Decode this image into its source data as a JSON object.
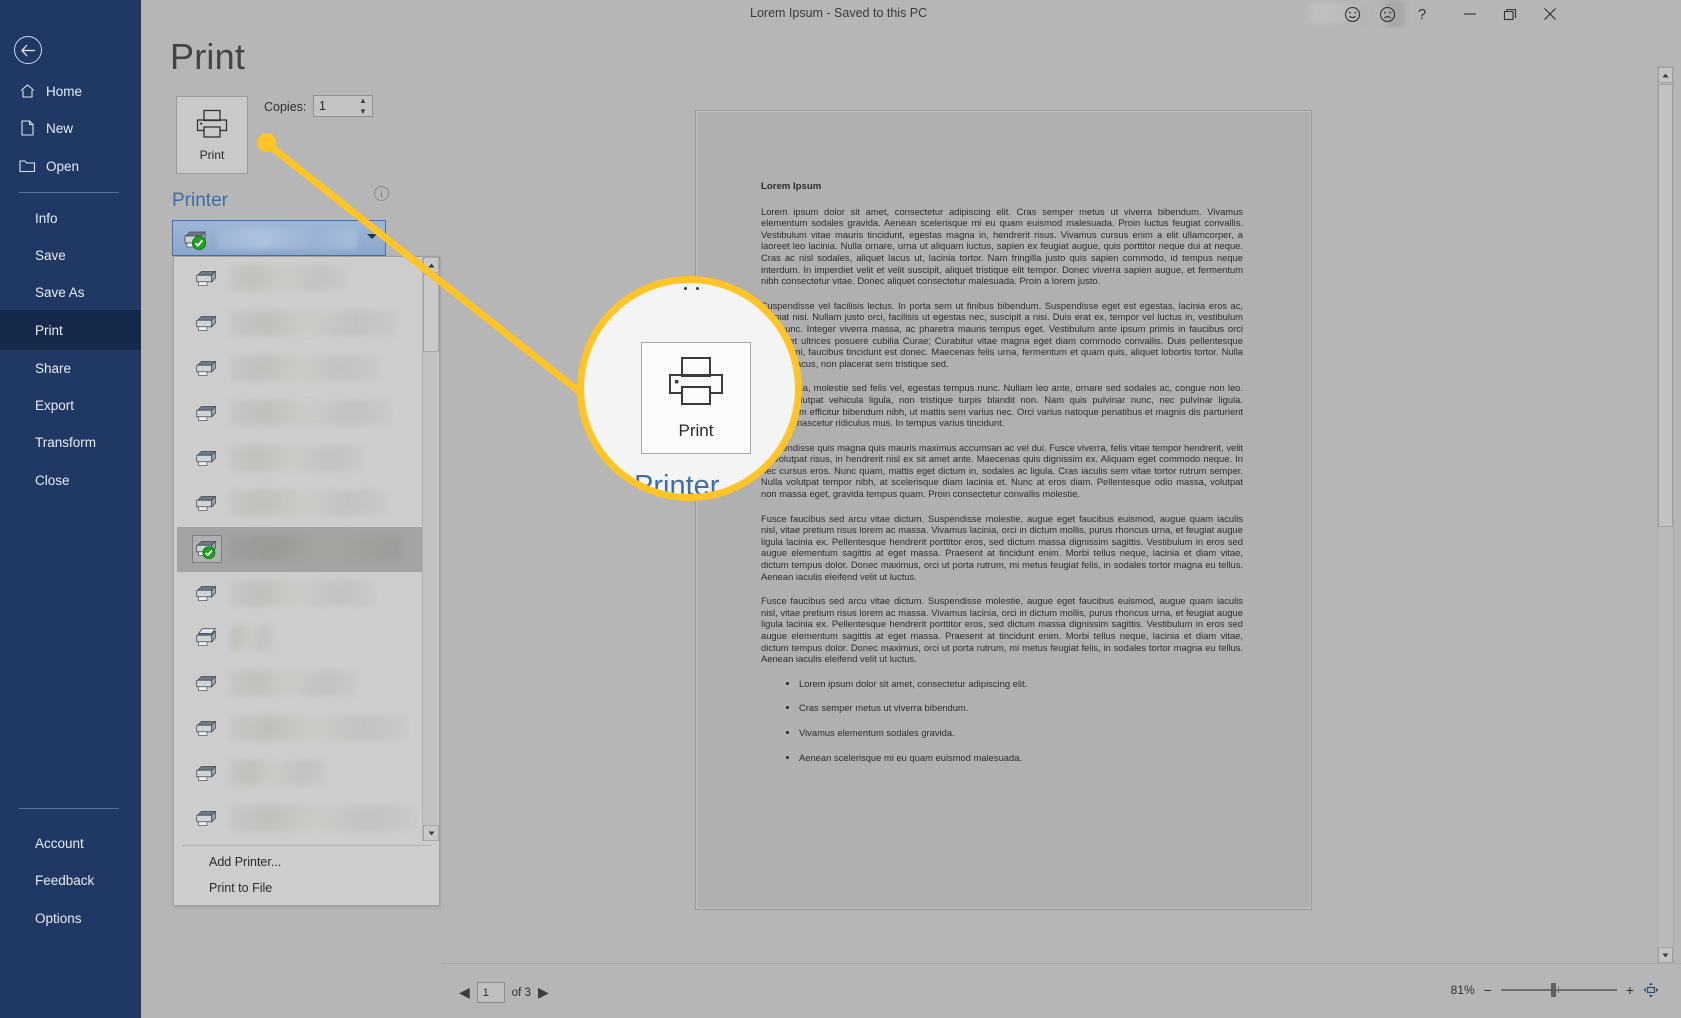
{
  "window": {
    "title": "Lorem Ipsum  -  Saved to this PC",
    "buttons": {
      "feedback_happy": "feedback-happy",
      "feedback_sad": "feedback-sad",
      "help": "?",
      "minimize": "minimize",
      "restore": "restore",
      "close": "close"
    }
  },
  "backstage": {
    "back_label": "back-arrow",
    "page_title": "Print",
    "nav": [
      {
        "label": "Home",
        "icon": "home-icon",
        "type": "top"
      },
      {
        "label": "New",
        "icon": "new-document-icon",
        "type": "top"
      },
      {
        "label": "Open",
        "icon": "open-folder-icon",
        "type": "top"
      },
      {
        "label": "Info",
        "type": "sub"
      },
      {
        "label": "Save",
        "type": "sub"
      },
      {
        "label": "Save As",
        "type": "sub"
      },
      {
        "label": "Print",
        "type": "sub",
        "active": true
      },
      {
        "label": "Share",
        "type": "sub"
      },
      {
        "label": "Export",
        "type": "sub"
      },
      {
        "label": "Transform",
        "type": "sub"
      },
      {
        "label": "Close",
        "type": "sub"
      }
    ],
    "nav_bottom": [
      {
        "label": "Account"
      },
      {
        "label": "Feedback"
      },
      {
        "label": "Options"
      }
    ]
  },
  "settings": {
    "print_button_label": "Print",
    "print_button_icon": "printer-icon",
    "copies_label": "Copies:",
    "copies_value": "1",
    "printer_section_label": "Printer",
    "info_icon_label": "i",
    "selected_printer_name": "",
    "dropdown": {
      "items": [
        {
          "name": "",
          "selected": false,
          "icon": "printer-icon",
          "blur_width": 116
        },
        {
          "name": "",
          "selected": false,
          "icon": "printer-icon",
          "blur_width": 168
        },
        {
          "name": "",
          "selected": false,
          "icon": "printer-icon",
          "blur_width": 150
        },
        {
          "name": "",
          "selected": false,
          "icon": "printer-icon",
          "blur_width": 162
        },
        {
          "name": "",
          "selected": false,
          "icon": "printer-icon",
          "blur_width": 135
        },
        {
          "name": "",
          "selected": false,
          "icon": "printer-icon",
          "blur_width": 158
        },
        {
          "name": "",
          "selected": true,
          "icon": "printer-icon-default",
          "blur_width": 172
        },
        {
          "name": "",
          "selected": false,
          "icon": "printer-icon",
          "blur_width": 146
        },
        {
          "name": "",
          "selected": false,
          "icon": "printer-icon-color",
          "blur_width": 44
        },
        {
          "name": "",
          "selected": false,
          "icon": "printer-icon",
          "blur_width": 128
        },
        {
          "name": "",
          "selected": false,
          "icon": "printer-icon",
          "blur_width": 178
        },
        {
          "name": "",
          "selected": false,
          "icon": "printer-icon",
          "blur_width": 96
        },
        {
          "name": "",
          "selected": false,
          "icon": "printer-icon",
          "blur_width": 186
        }
      ],
      "actions": [
        {
          "label": "Add Printer..."
        },
        {
          "label": "Print to File"
        }
      ]
    }
  },
  "preview": {
    "document": {
      "heading": "Lorem Ipsum",
      "paragraphs": [
        "Lorem ipsum dolor sit amet, consectetur adipiscing elit. Cras semper metus ut viverra bibendum. Vivamus elementum sodales gravida. Aenean scelerisque mi eu quam euismod malesuada. Proin luctus feugiat convallis. Vestibulum vitae mauris tincidunt, egestas magna in, hendrerit risus. Vivamus cursus enim a elit ullamcorper, a laoreet leo lacinia. Nulla ornare, urna ut aliquam luctus, sapien ex feugiat augue, quis porttitor neque dui at neque. Cras ac nisl sodales, aliquet lacus ut, lacinia tortor. Nam fringilla justo quis sapien commodo, id tempus neque interdum. In imperdiet velit et velit suscipit, aliquet tristique elit tempor. Donec viverra sapien augue, et fermentum nibh consectetur vitae. Donec aliquet consectetur malesuada. Proin a lorem justo.",
        "Suspendisse vel facilisis lectus. In porta sem ut finibus bibendum. Suspendisse eget est egestas, lacinia eros ac, feugiat nisi. Nullam justo orci, facilisis ut egestas nec, suscipit a nisi. Duis erat ex, tempor vel luctus in, vestibulum sed nunc. Integer viverra massa, ac pharetra mauris tempus eget. Vestibulum ante ipsum primis in faucibus orci luctus et ultrices posuere cubilia Curae; Curabitur vitae magna eget diam commodo convallis. Duis pellentesque laoreet mi, faucibus tincidunt est donec. Maecenas felis urna, fermentum et quam quis, aliquet lobortis tortor. Nulla facilisis lacus, non placerat sem tristique sed.",
        "Etiam nulla, molestie sed felis vel, egestas tempus nunc. Nullam leo ante, ornare sed sodales ac, congue non leo. Etiam volutpat vehicula ligula, non tristique turpis blandit non. Nam quis pulvinar nunc, nec pulvinar ligula. Vestibulum efficitur bibendum nibh, ut mattis sem varius nec. Orci varius natoque penatibus et magnis dis parturient montes, nascetur ridiculus mus. In tempus varius tincidunt.",
        "Suspendisse quis magna quis mauris maximus accumsan ac vel dui. Fusce viverra, felis vitae tempor hendrerit, velit mi volutpat risus, in hendrerit nisl ex sit amet ante. Maecenas quis dignissim ex. Aliquam eget commodo neque. In nec cursus eros. Nunc quam, mattis eget dictum in, sodales ac ligula. Cras iaculis sem vitae tortor rutrum semper. Nulla volutpat tempor nibh, at scelerisque diam lacinia et. Nunc at eros diam. Pellentesque odio massa, volutpat non massa eget, gravida tempus quam. Proin consectetur convallis molestie.",
        "Fusce faucibus sed arcu vitae dictum. Suspendisse molestie, augue eget faucibus euismod, augue quam iaculis nisl, vitae pretium risus lorem ac massa. Vivamus lacinia, orci in dictum mollis, purus rhoncus urna, et feugiat augue ligula lacinia ex. Pellentesque hendrerit porttitor eros, sed dictum massa dignissim sagittis. Vestibulum in eros sed augue elementum sagittis at eget massa. Praesent at tincidunt enim. Morbi tellus neque, lacinia et diam vitae, dictum tempus dolor. Donec maximus, orci ut porta rutrum, mi metus feugiat felis, in sodales tortor magna eu tellus. Aenean iaculis eleifend velit ut luctus.",
        "Fusce faucibus sed arcu vitae dictum. Suspendisse molestie, augue eget faucibus euismod, augue quam iaculis nisl, vitae pretium risus lorem ac massa. Vivamus lacinia, orci in dictum mollis, purus rhoncus urna, et feugiat augue ligula lacinia ex. Pellentesque hendrerit porttitor eros, sed dictum massa dignissim sagittis. Vestibulum in eros sed augue elementum sagittis at eget massa. Praesent at tincidunt enim. Morbi tellus neque, lacinia et diam vitae, dictum tempus dolor. Donec maximus, orci ut porta rutrum, mi metus feugiat felis, in sodales tortor magna eu tellus. Aenean iaculis eleifend velit ut luctus."
      ],
      "bullets": [
        "Lorem ipsum dolor sit amet, consectetur adipiscing elit.",
        "Cras semper metus ut viverra bibendum.",
        "Vivamus elementum sodales gravida.",
        "Aenean scelerisque mi eu quam euismod malesuada."
      ]
    }
  },
  "statusbar": {
    "prev_label": "previous-page",
    "page_value": "1",
    "of_label": "of 3",
    "next_label": "next-page",
    "zoom_percent": "81%",
    "zoom_out": "−",
    "zoom_in": "+",
    "zoom_to_page": "zoom-to-page-icon"
  },
  "callout": {
    "magnified_print_label": "Print",
    "magnified_printer_label": "Printer",
    "accent_color": "#ffc425"
  },
  "colors": {
    "nav_background": "#1f3864",
    "nav_active": "#15294b",
    "section_heading": "#3d6ea5",
    "body_background": "#b6b6b6",
    "callout_yellow": "#ffc425",
    "default_printer_check": "#22aa22"
  }
}
